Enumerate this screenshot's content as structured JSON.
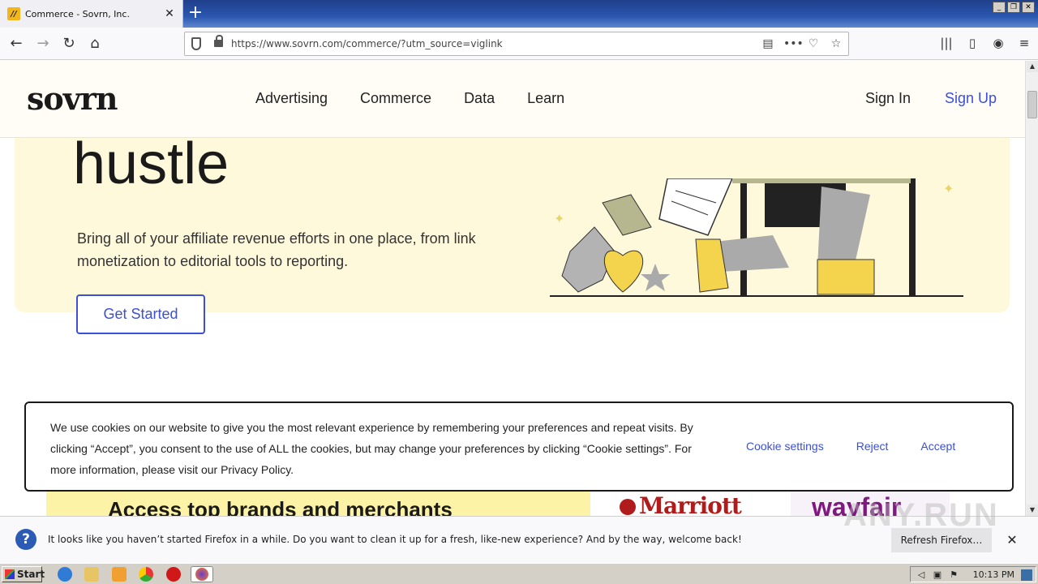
{
  "browser": {
    "tab_title": "Commerce - Sovrn, Inc.",
    "tab_close": "✕",
    "new_tab": "+",
    "url": "https://www.sovrn.com/commerce/?utm_source=viglink",
    "window_buttons": [
      "_",
      "❐",
      "✕"
    ]
  },
  "site": {
    "logo": "sovrn",
    "nav": [
      "Advertising",
      "Commerce",
      "Data",
      "Learn"
    ],
    "sign_in": "Sign In",
    "sign_up": "Sign Up"
  },
  "hero": {
    "heading_fragment": "hustle",
    "subtitle": "Bring all of your affiliate revenue efforts in one place, from link monetization to editorial tools to reporting.",
    "cta": "Get Started"
  },
  "brands": {
    "title": "Access top brands and merchants",
    "logos": [
      "Marriott",
      "wayfair"
    ]
  },
  "cookie_banner": {
    "text": "We use cookies on our website to give you the most relevant experience by remembering your preferences and repeat visits. By clicking “Accept”, you consent to the use of ALL the cookies, but may change your preferences by clicking “Cookie settings”. For more information, please visit our Privacy Policy.",
    "settings": "Cookie settings",
    "reject": "Reject",
    "accept": "Accept"
  },
  "notification": {
    "text": "It looks like you haven’t started Firefox in a while. Do you want to clean it up for a fresh, like-new experience? And by the way, welcome back!",
    "button": "Refresh Firefox…",
    "close": "✕"
  },
  "taskbar": {
    "start": "Start",
    "clock": "10:13 PM"
  },
  "watermark": "ANY.RUN",
  "colors": {
    "accent": "#3b4fd8",
    "hero_bg": "#fff9dc",
    "header_bg": "#fffdf5"
  }
}
